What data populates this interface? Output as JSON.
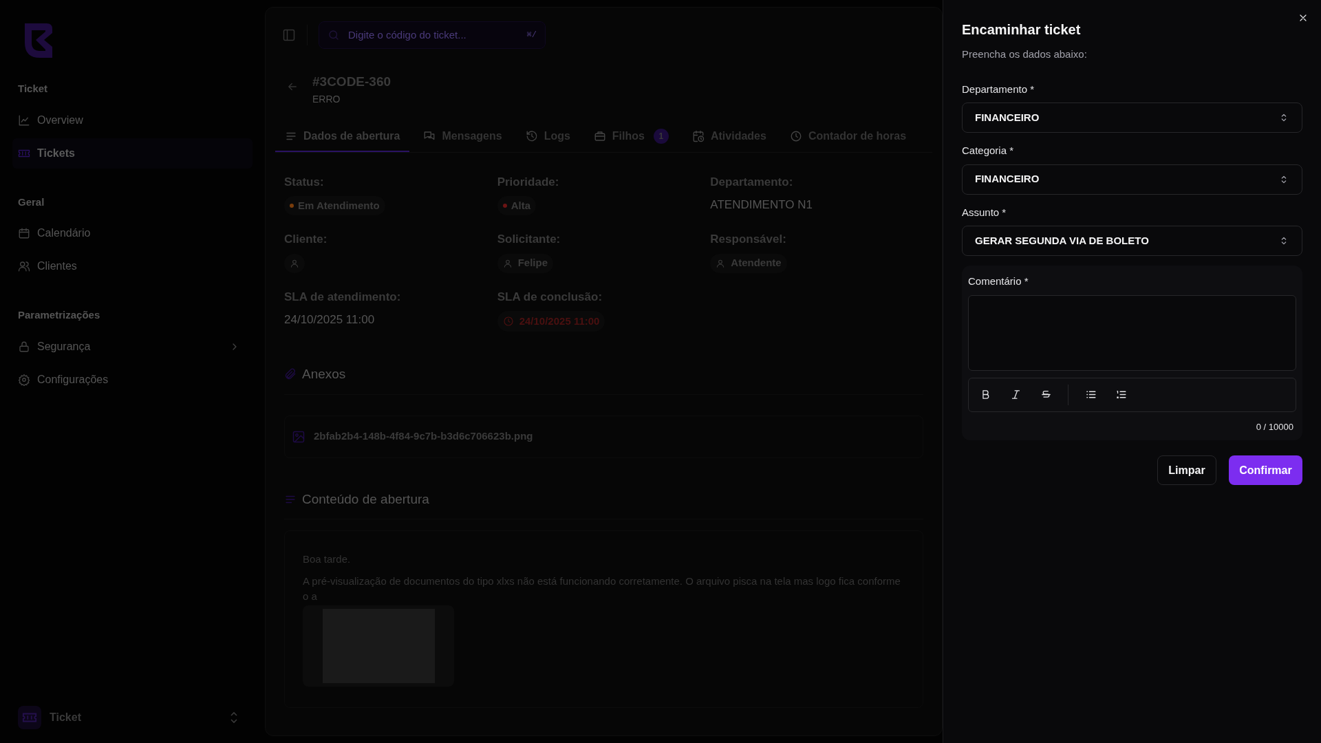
{
  "sidebar": {
    "groups": [
      {
        "label": "Ticket",
        "items": [
          {
            "label": "Overview",
            "selected": false
          },
          {
            "label": "Tickets",
            "selected": true
          }
        ]
      },
      {
        "label": "Geral",
        "items": [
          {
            "label": "Calendário",
            "selected": false
          },
          {
            "label": "Clientes",
            "selected": false
          }
        ]
      },
      {
        "label": "Parametrizações",
        "items": [
          {
            "label": "Segurança",
            "selected": false,
            "expandable": true
          },
          {
            "label": "Configurações",
            "selected": false
          }
        ]
      }
    ],
    "footer": {
      "label": "Ticket"
    }
  },
  "search": {
    "placeholder": "Digite o código do ticket...",
    "shortcut": "⌘/"
  },
  "ticket": {
    "code": "#3CODE-360",
    "type": "ERRO"
  },
  "tabs": [
    {
      "label": "Dados de abertura",
      "selected": true
    },
    {
      "label": "Mensagens",
      "selected": false
    },
    {
      "label": "Logs",
      "selected": false
    },
    {
      "label": "Filhos",
      "selected": false,
      "badge": "1"
    },
    {
      "label": "Atividades",
      "selected": false
    },
    {
      "label": "Contador de horas",
      "selected": false
    }
  ],
  "fields": [
    {
      "label": "Status:",
      "kind": "dot",
      "value": "Em Atendimento",
      "color": "#7a3d0c"
    },
    {
      "label": "Prioridade:",
      "kind": "dot",
      "value": "Alta",
      "color": "#6b1414"
    },
    {
      "label": "Departamento:",
      "kind": "text",
      "value": "ATENDIMENTO N1"
    },
    {
      "label": "Cliente:",
      "kind": "person"
    },
    {
      "label": "Solicitante:",
      "kind": "person",
      "value": "Felipe"
    },
    {
      "label": "Responsável:",
      "kind": "person",
      "value": "Atendente"
    },
    {
      "label": "SLA de atendimento:",
      "kind": "text",
      "value": "24/10/2025 11:00"
    },
    {
      "label": "SLA de conclusão:",
      "kind": "overdue",
      "value": "24/10/2025 11:00"
    }
  ],
  "attachments": {
    "title": "Anexos",
    "files": [
      "2bfab2b4-148b-4f84-9c7b-b3d6c706623b.png"
    ]
  },
  "opening_content": {
    "title": "Conteúdo de abertura",
    "paragraphs": [
      "Boa tarde.",
      "A pré-visualização de documentos do tipo xlxs não está funcionando corretamente. O arquivo pisca na tela mas logo fica conforme o a"
    ]
  },
  "drawer": {
    "title": "Encaminhar ticket",
    "subtitle": "Preencha os dados abaixo:",
    "selects": [
      {
        "label": "Departamento *",
        "value": "FINANCEIRO"
      },
      {
        "label": "Categoria *",
        "value": "FINANCEIRO"
      },
      {
        "label": "Assunto *",
        "value": "GERAR SEGUNDA VIA DE BOLETO"
      }
    ],
    "comment": {
      "label": "Comentário *",
      "counter": "0 / 10000"
    },
    "buttons": [
      {
        "label": "Limpar",
        "kind": "secondary"
      },
      {
        "label": "Confirmar",
        "kind": "primary"
      }
    ]
  }
}
